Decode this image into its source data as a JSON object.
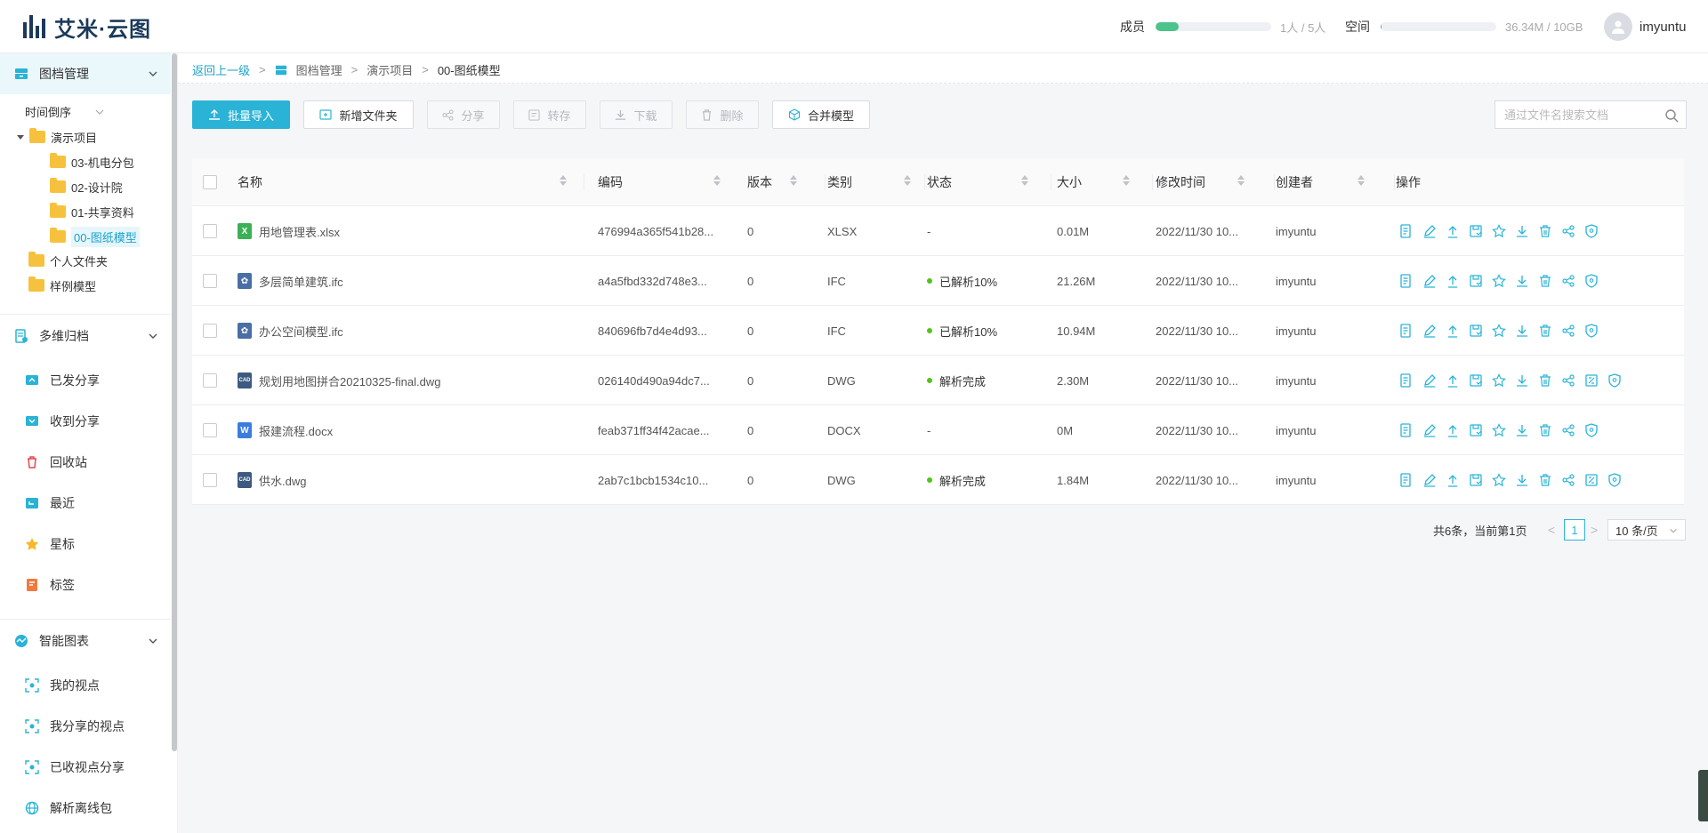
{
  "header": {
    "logo_text": "艾米·云图",
    "members": {
      "label": "成员",
      "value": "1人 / 5人",
      "fill_percent": 20,
      "color": "#4cc38a"
    },
    "storage": {
      "label": "空间",
      "value": "36.34M / 10GB",
      "fill_percent": 1,
      "color": "#2ab3d6"
    },
    "username": "imyuntu"
  },
  "sidebar": {
    "section1": {
      "label": "图档管理",
      "icon": "archive-icon"
    },
    "sort_label": "时间倒序",
    "tree": [
      {
        "label": "演示项目",
        "expanded": true
      },
      {
        "label": "03-机电分包"
      },
      {
        "label": "02-设计院"
      },
      {
        "label": "01-共享资料"
      },
      {
        "label": "00-图纸模型",
        "selected": true
      },
      {
        "label": "个人文件夹"
      },
      {
        "label": "样例模型"
      }
    ],
    "section2": {
      "label": "多维归档",
      "items": [
        {
          "label": "已发分享",
          "icon": "share-sent-icon"
        },
        {
          "label": "收到分享",
          "icon": "share-received-icon"
        },
        {
          "label": "回收站",
          "icon": "trash-icon"
        },
        {
          "label": "最近",
          "icon": "recent-icon"
        },
        {
          "label": "星标",
          "icon": "star-icon"
        },
        {
          "label": "标签",
          "icon": "tag-icon"
        }
      ]
    },
    "section3": {
      "label": "智能图表",
      "items": [
        {
          "label": "我的视点",
          "icon": "viewpoint-icon"
        },
        {
          "label": "我分享的视点",
          "icon": "viewpoint-icon"
        },
        {
          "label": "已收视点分享",
          "icon": "viewpoint-icon"
        },
        {
          "label": "解析离线包",
          "icon": "globe-icon"
        }
      ]
    }
  },
  "breadcrumb": {
    "back": "返回上一级",
    "sep": ">",
    "items": [
      "图档管理",
      "演示项目",
      "00-图纸模型"
    ]
  },
  "toolbar": {
    "import": "批量导入",
    "new_folder": "新增文件夹",
    "share": "分享",
    "transfer": "转存",
    "download": "下载",
    "delete": "删除",
    "merge": "合并模型",
    "search_placeholder": "通过文件名搜索文档"
  },
  "table": {
    "columns": [
      "名称",
      "编码",
      "版本",
      "类别",
      "状态",
      "大小",
      "修改时间",
      "创建者",
      "操作"
    ],
    "rows": [
      {
        "name": "用地管理表.xlsx",
        "code": "476994a365f541b28...",
        "version": "0",
        "type": "XLSX",
        "status": "-",
        "size": "0.01M",
        "modified": "2022/11/30 10...",
        "creator": "imyuntu",
        "ficon": "X",
        "fcolor": "#3cb054"
      },
      {
        "name": "多层简单建筑.ifc",
        "code": "a4a5fbd332d748e3...",
        "version": "0",
        "type": "IFC",
        "status": "已解析10%",
        "size": "21.26M",
        "modified": "2022/11/30 10...",
        "creator": "imyuntu",
        "ficon": "✿",
        "fcolor": "#4a6fa5"
      },
      {
        "name": "办公空间模型.ifc",
        "code": "840696fb7d4e4d93...",
        "version": "0",
        "type": "IFC",
        "status": "已解析10%",
        "size": "10.94M",
        "modified": "2022/11/30 10...",
        "creator": "imyuntu",
        "ficon": "✿",
        "fcolor": "#4a6fa5"
      },
      {
        "name": "规划用地图拼合20210325-final.dwg",
        "code": "026140d490a94dc7...",
        "version": "0",
        "type": "DWG",
        "status": "解析完成",
        "size": "2.30M",
        "modified": "2022/11/30 10...",
        "creator": "imyuntu",
        "ficon": "CAD",
        "fcolor": "#3d5a80"
      },
      {
        "name": "报建流程.docx",
        "code": "feab371ff34f42acae...",
        "version": "0",
        "type": "DOCX",
        "status": "-",
        "size": "0M",
        "modified": "2022/11/30 10...",
        "creator": "imyuntu",
        "ficon": "W",
        "fcolor": "#3b7ddd"
      },
      {
        "name": "供水.dwg",
        "code": "2ab7c1bcb1534c10...",
        "version": "0",
        "type": "DWG",
        "status": "解析完成",
        "size": "1.84M",
        "modified": "2022/11/30 10...",
        "creator": "imyuntu",
        "ficon": "CAD",
        "fcolor": "#3d5a80"
      }
    ]
  },
  "pagination": {
    "summary": "共6条，当前第1页",
    "prev": "<",
    "page": "1",
    "next": ">",
    "page_size": "10 条/页"
  },
  "colors": {
    "accent": "#2ab3d6",
    "folder": "#f6c23d",
    "success": "#52c41a"
  }
}
